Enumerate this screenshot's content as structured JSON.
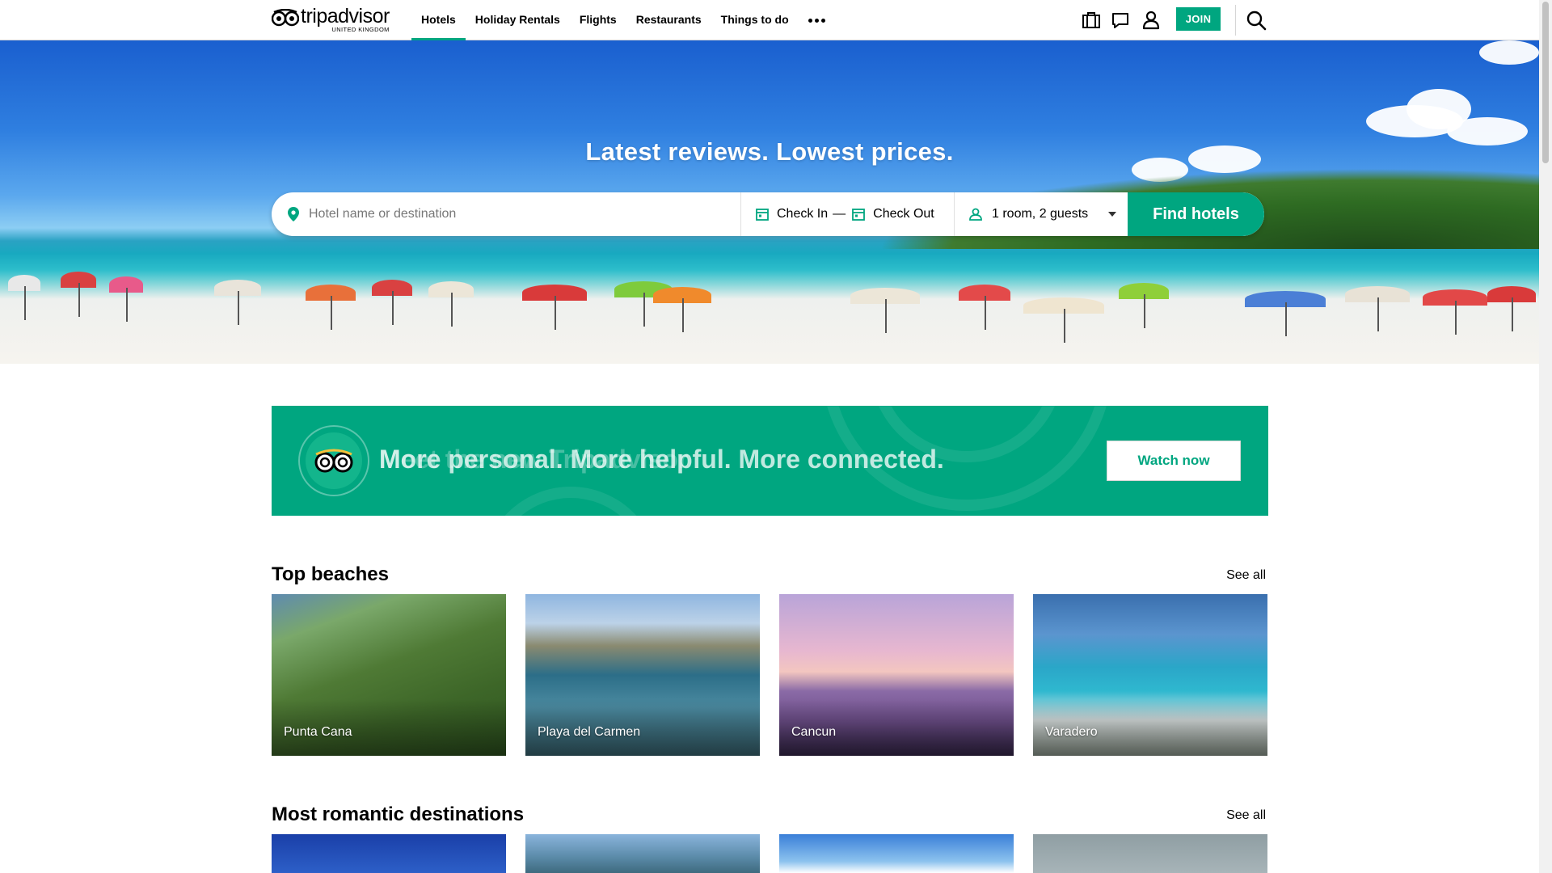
{
  "header": {
    "logo_word": "tripadvisor",
    "logo_sub": "UNITED KINGDOM",
    "nav": [
      "Hotels",
      "Holiday Rentals",
      "Flights",
      "Restaurants",
      "Things to do"
    ],
    "active_nav": "Hotels",
    "join_label": "JOIN",
    "icons": [
      "trips-icon",
      "messages-icon",
      "account-icon",
      "search-icon",
      "more-icon"
    ]
  },
  "hero": {
    "title": "Latest reviews. Lowest prices.",
    "search": {
      "destination_placeholder": "Hotel name or destination",
      "check_in": "Check In",
      "dash": "—",
      "check_out": "Check Out",
      "guests": "1 room, 2 guests",
      "find_label": "Find hotels"
    }
  },
  "promo": {
    "text": "More personal. More helpful. More connected.",
    "overlay_text": "Meet the new Tripadvisor",
    "button": "Watch now"
  },
  "sections": [
    {
      "title": "Top beaches",
      "see_all": "See all",
      "cards": [
        "Punta Cana",
        "Playa del Carmen",
        "Cancun",
        "Varadero"
      ]
    },
    {
      "title": "Most romantic destinations",
      "see_all": "See all",
      "cards": [
        "",
        "",
        "",
        ""
      ]
    }
  ],
  "colors": {
    "brand": "#00a680",
    "text": "#000000"
  }
}
